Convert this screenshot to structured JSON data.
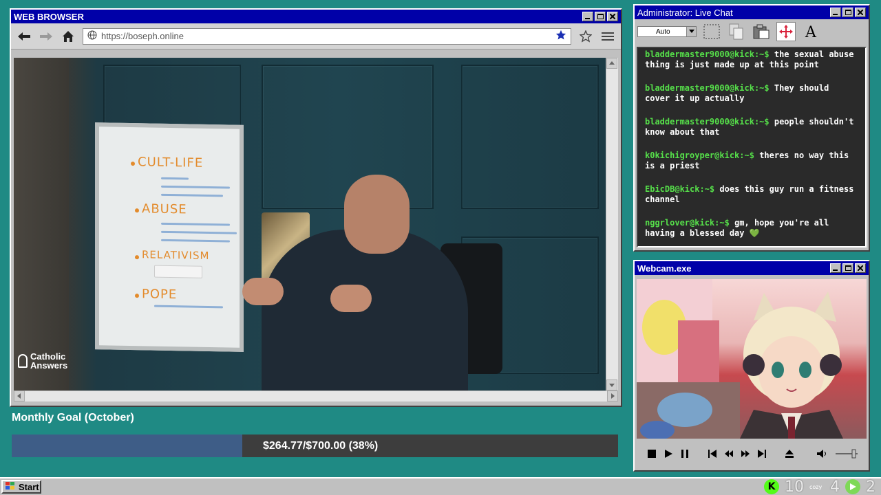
{
  "browser": {
    "title": "WEB BROWSER",
    "url": "https://boseph.online"
  },
  "video": {
    "board": [
      "CULT-LIFE",
      "ABUSE",
      "RELATIVISM",
      "POPE"
    ],
    "watermark": [
      "Catholic",
      "Answers"
    ]
  },
  "goal": {
    "title": "Monthly Goal (October)",
    "progress_text": "$264.77/$700.00 (38%)",
    "progress_fraction": 0.38
  },
  "chat": {
    "title": "Administrator: Live Chat",
    "font_select": "Auto",
    "messages": [
      {
        "user": "bladdermaster9000@kick:~$",
        "text": "the sexual abuse thing is just made up at this point"
      },
      {
        "user": "bladdermaster9000@kick:~$",
        "text": "They should cover it up actually"
      },
      {
        "user": "bladdermaster9000@kick:~$",
        "text": "people shouldn't know about that"
      },
      {
        "user": "k0kichigroyper@kick:~$",
        "text": "theres no way this is a priest"
      },
      {
        "user": "EbicDB@kick:~$",
        "text": "does this guy run a fitness channel"
      },
      {
        "user": "nggrlover@kick:~$",
        "text": "gm, hope you're all having a blessed day 💚"
      }
    ]
  },
  "webcam": {
    "title": "Webcam.exe"
  },
  "taskbar": {
    "start_label": "Start",
    "kick_count": "10",
    "cozy_label": "cozy",
    "cozy_count": "4",
    "other_count": "2"
  },
  "colors": {
    "desktop": "#1f8a84",
    "titlebar": "#0000a8",
    "chat_username": "#56e04a",
    "goal_fill": "#3e5d87"
  }
}
